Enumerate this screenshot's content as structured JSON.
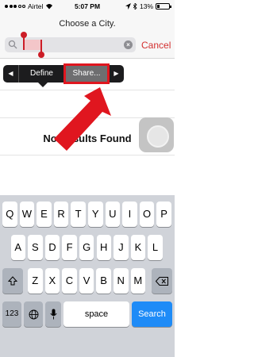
{
  "status_bar": {
    "carrier": "Airtel",
    "time": "5:07 PM",
    "battery": "13%"
  },
  "header": {
    "prompt": "Choose a City.",
    "cancel_label": "Cancel"
  },
  "edit_menu": {
    "define_label": "Define",
    "share_label": "Share..."
  },
  "results": {
    "empty_text": "No Results Found"
  },
  "keyboard": {
    "row1": [
      "Q",
      "W",
      "E",
      "R",
      "T",
      "Y",
      "U",
      "I",
      "O",
      "P"
    ],
    "row2": [
      "A",
      "S",
      "D",
      "F",
      "G",
      "H",
      "J",
      "K",
      "L"
    ],
    "row3": [
      "Z",
      "X",
      "C",
      "V",
      "B",
      "N",
      "M"
    ],
    "numbers_label": "123",
    "space_label": "space",
    "search_label": "Search"
  },
  "colors": {
    "cancel": "#d32f2f",
    "annotation": "#e0161f",
    "search_key": "#1e8bf7"
  }
}
